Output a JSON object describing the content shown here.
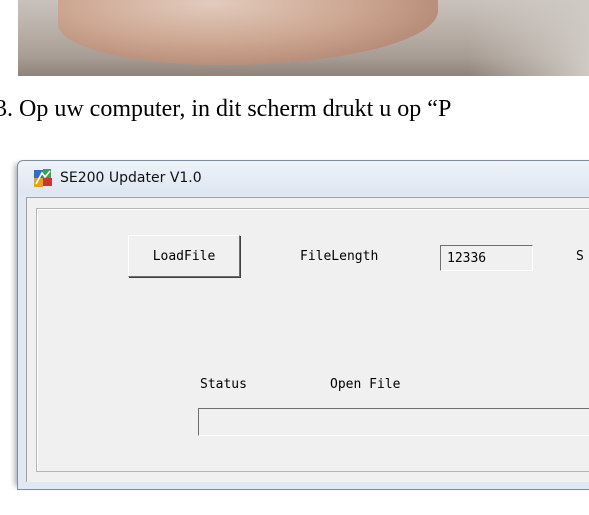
{
  "caption": "3. Op uw computer, in dit scherm drukt u op “P",
  "window": {
    "title": "SE200 Updater V1.0",
    "load_button": "LoadFile",
    "file_length_label": "FileLength",
    "file_length_value": "12336",
    "cut_label": "S",
    "status_label": "Status",
    "status_text": "Open File",
    "status_field_value": ""
  },
  "colors": {
    "titlebar": "#dfe8f3",
    "dialog_bg": "#f0f0f0"
  },
  "icons": {
    "app": "app-icon"
  }
}
